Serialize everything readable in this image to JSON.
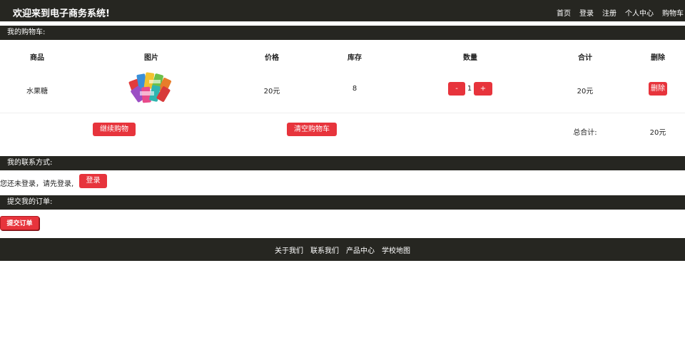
{
  "header": {
    "title": "欢迎来到电子商务系统!",
    "nav": [
      "首页",
      "登录",
      "注册",
      "个人中心",
      "购物车"
    ]
  },
  "cart": {
    "section_title": "我的购物车:",
    "columns": [
      "商品",
      "图片",
      "价格",
      "库存",
      "数量",
      "合计",
      "删除"
    ],
    "items": [
      {
        "name": "水果糖",
        "image_icon": "candy-product-image",
        "price": "20元",
        "stock": "8",
        "qty_minus_label": "-",
        "quantity": "1",
        "qty_plus_label": "+",
        "subtotal": "20元",
        "delete_label": "删除"
      }
    ],
    "continue_label": "继续购物",
    "clear_label": "清空购物车",
    "total_label": "总合计:",
    "total_value": "20元"
  },
  "contact": {
    "section_title": "我的联系方式:",
    "message": "您还未登录，请先登录,",
    "login_label": "登录"
  },
  "order": {
    "section_title": "提交我的订单:",
    "submit_label": "提交订单"
  },
  "footer": {
    "links": [
      "关于我们",
      "联系我们",
      "产品中心",
      "学校地图"
    ]
  },
  "colors": {
    "dark_bar": "#262621",
    "accent_red": "#e7343c",
    "background": "#ffffff"
  }
}
